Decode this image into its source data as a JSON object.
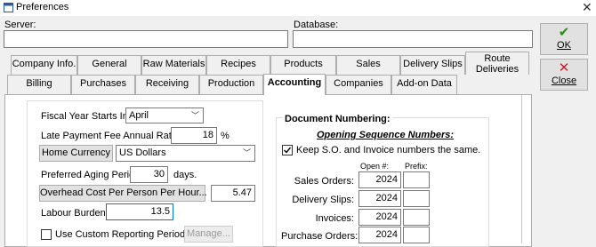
{
  "window": {
    "title": "Preferences",
    "close_glyph": "✕",
    "icon": "preferences-window-icon"
  },
  "server": {
    "label": "Server:",
    "value": ""
  },
  "database": {
    "label": "Database:",
    "value": ""
  },
  "buttons": {
    "ok": {
      "label": "OK",
      "icon": "checkmark-icon",
      "icon_glyph": "✔",
      "color": "#2e8b1a"
    },
    "close": {
      "label": "Close",
      "icon": "x-icon",
      "icon_glyph": "✕",
      "color": "#c0202a"
    }
  },
  "tabs_row1": [
    "Company Info.",
    "General",
    "Raw Materials",
    "Recipes",
    "Products",
    "Sales",
    "Delivery Slips",
    "Route Deliveries"
  ],
  "tabs_row2": [
    "Billing",
    "Purchases",
    "Receiving",
    "Production",
    "Accounting",
    "Companies",
    "Add-on Data"
  ],
  "active_tab": "Accounting",
  "accounting": {
    "fiscal_year": {
      "label": "Fiscal Year Starts In:",
      "value": "April"
    },
    "late_fee": {
      "label": "Late Payment Fee Annual Rate:",
      "value": "18",
      "unit": "%"
    },
    "home_currency": {
      "button": "Home Currency",
      "value": "US Dollars"
    },
    "aging": {
      "label": "Preferred Aging Period:",
      "value": "30",
      "unit": "days."
    },
    "overhead": {
      "button": "Overhead Cost Per Person Per Hour...",
      "value": "5.47"
    },
    "labour": {
      "label": "Labour Burden:",
      "value": "13.5"
    },
    "custom_reporting": {
      "label": "Use Custom Reporting Periods",
      "checked": false,
      "manage": "Manage..."
    }
  },
  "doc_numbering": {
    "title": "Document Numbering:",
    "subtitle": "Opening Sequence Numbers:",
    "keep_same": {
      "label": "Keep S.O. and Invoice numbers the same.",
      "checked": true
    },
    "col_open": "Open #:",
    "col_prefix": "Prefix:",
    "rows": [
      {
        "label": "Sales Orders:",
        "open": "2024",
        "prefix": ""
      },
      {
        "label": "Delivery Slips:",
        "open": "2024",
        "prefix": ""
      },
      {
        "label": "Invoices:",
        "open": "2024",
        "prefix": ""
      },
      {
        "label": "Purchase Orders:",
        "open": "2024",
        "prefix": ""
      }
    ]
  }
}
